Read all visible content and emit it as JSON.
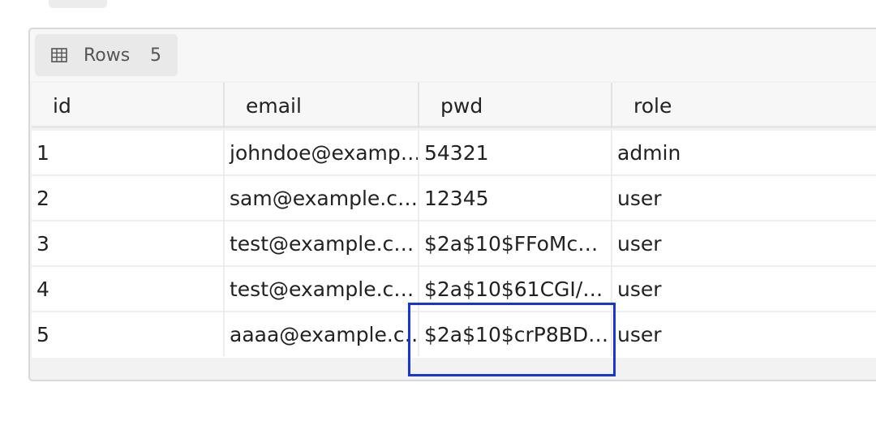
{
  "tab": {
    "label": "Rows",
    "count": "5",
    "icon": "table-grid-icon"
  },
  "columns": [
    "id",
    "email",
    "pwd",
    "role"
  ],
  "rows": [
    {
      "id": "1",
      "email": "johndoe@examp…",
      "pwd": "54321",
      "role": "admin"
    },
    {
      "id": "2",
      "email": "sam@example.c…",
      "pwd": "12345",
      "role": "user"
    },
    {
      "id": "3",
      "email": "test@example.c…",
      "pwd": "$2a$10$FFoMc…",
      "role": "user"
    },
    {
      "id": "4",
      "email": "test@example.c…",
      "pwd": "$2a$10$61CGI/…",
      "role": "user"
    },
    {
      "id": "5",
      "email": "aaaa@example.c…",
      "pwd": "$2a$10$crP8BD…",
      "role": "user"
    }
  ],
  "colors": {
    "highlight": "#1836d8"
  }
}
